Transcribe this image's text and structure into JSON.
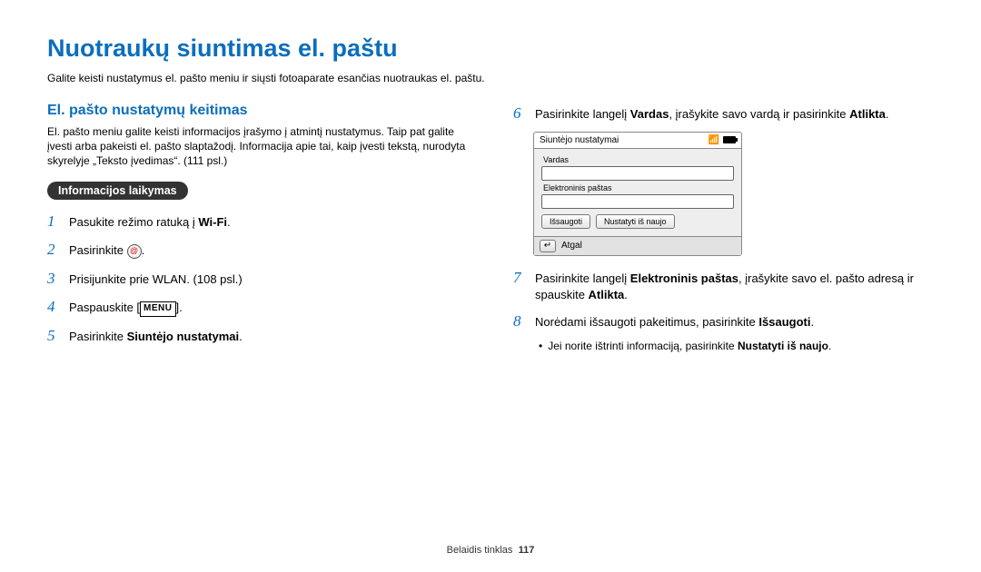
{
  "title": "Nuotraukų siuntimas el. paštu",
  "intro": "Galite keisti nustatymus el. pašto meniu ir siųsti fotoaparate esančias nuotraukas el. paštu.",
  "left": {
    "section_title": "El. pašto nustatymų keitimas",
    "section_desc": "El. pašto meniu galite keisti informacijos įrašymo į atmintį nustatymus. Taip pat galite įvesti arba pakeisti el. pašto slaptažodį. Informacija apie tai, kaip įvesti tekstą, nurodyta skyrelyje „Teksto įvedimas“. (111 psl.)",
    "pill": "Informacijos laikymas",
    "steps": [
      {
        "n": "1",
        "pre": "Pasukite režimo ratuką į ",
        "wifi": "Wi-Fi",
        "post": "."
      },
      {
        "n": "2",
        "pre": "Pasirinkite ",
        "icon": true,
        "post": "."
      },
      {
        "n": "3",
        "text": "Prisijunkite prie WLAN. (108 psl.)"
      },
      {
        "n": "4",
        "pre": "Paspauskite [",
        "menu": "MENU",
        "post": "]."
      },
      {
        "n": "5",
        "pre": "Pasirinkite ",
        "bold": "Siuntėjo nustatymai",
        "post": "."
      }
    ]
  },
  "right": {
    "step6": {
      "n": "6",
      "parts": [
        "Pasirinkite langelį ",
        "Vardas",
        ", įrašykite savo vardą ir pasirinkite ",
        "Atlikta",
        "."
      ]
    },
    "device": {
      "header": "Siuntėjo nustatymai",
      "label1": "Vardas",
      "label2": "Elektroninis paštas",
      "btn_save": "Išsaugoti",
      "btn_reset": "Nustatyti iš naujo",
      "back": "Atgal"
    },
    "step7": {
      "n": "7",
      "parts": [
        "Pasirinkite langelį ",
        "Elektroninis paštas",
        ", įrašykite savo el. pašto adresą ir spauskite ",
        "Atlikta",
        "."
      ]
    },
    "step8": {
      "n": "8",
      "parts": [
        "Norėdami išsaugoti pakeitimus, pasirinkite ",
        "Išsaugoti",
        "."
      ]
    },
    "sub": {
      "parts": [
        "Jei norite ištrinti informaciją, pasirinkite ",
        "Nustatyti iš naujo",
        "."
      ]
    }
  },
  "footer": {
    "section": "Belaidis tinklas",
    "page": "117"
  }
}
